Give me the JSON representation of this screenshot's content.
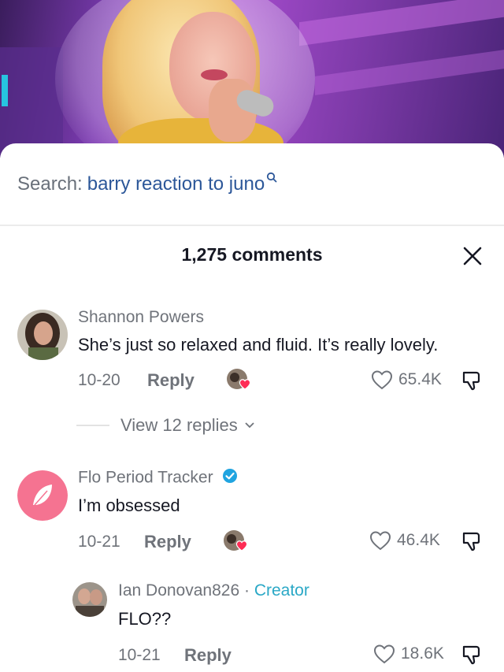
{
  "search": {
    "label": "Search:",
    "term": "barry reaction to juno"
  },
  "comments_header": {
    "count_label": "1,275 comments"
  },
  "comments": [
    {
      "username": "Shannon Powers",
      "text": "She’s just so relaxed and fluid. It’s really lovely.",
      "date": "10-20",
      "reply_label": "Reply",
      "likes": "65.4K",
      "view_replies": "View 12 replies"
    },
    {
      "username": "Flo Period Tracker",
      "verified": true,
      "text": "I’m obsessed",
      "date": "10-21",
      "reply_label": "Reply",
      "likes": "46.4K"
    },
    {
      "username": "Ian Donovan826",
      "separator": " · ",
      "badge": "Creator",
      "text": "FLO??",
      "date": "10-21",
      "reply_label": "Reply",
      "likes": "18.6K"
    }
  ],
  "icons": {
    "search": "search-icon",
    "close": "close-icon",
    "heart": "heart-outline-icon",
    "dislike": "thumbs-down-icon",
    "creator_liked": "creator-liked-heart-icon",
    "verified": "verified-badge-icon",
    "chevron": "chevron-down-icon"
  },
  "colors": {
    "search_term": "#2c5799",
    "creator_badge": "#2aa8c6",
    "verified": "#20a4e0",
    "like_heart_red": "#fe2c55",
    "flo_brand": "#f57391"
  }
}
